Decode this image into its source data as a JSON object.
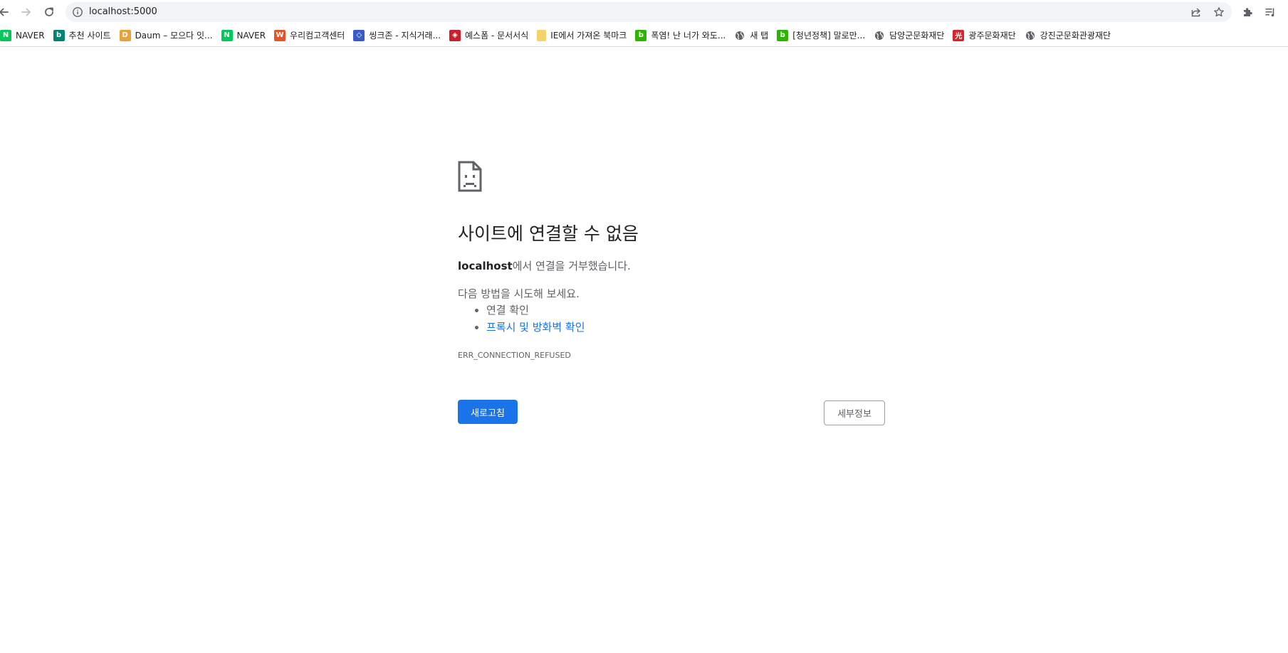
{
  "browser": {
    "url": "localhost:5000"
  },
  "bookmarks": [
    {
      "label": "NAVER",
      "favicon": "naver-icon",
      "color": "#03c75a",
      "glyph": "N"
    },
    {
      "label": "추천 사이트",
      "favicon": "bing-icon",
      "color": "#008373",
      "glyph": "b"
    },
    {
      "label": "Daum – 모으다 잇...",
      "favicon": "daum-icon",
      "color": "#e8a23c",
      "glyph": "D"
    },
    {
      "label": "NAVER",
      "favicon": "naver-icon",
      "color": "#03c75a",
      "glyph": "N"
    },
    {
      "label": "우리컴고객센터",
      "favicon": "wooricom-icon",
      "color": "#e2562b",
      "glyph": "W"
    },
    {
      "label": "씽크존 - 지식거래...",
      "favicon": "thinkzone-icon",
      "color": "#3a5bc7",
      "glyph": "◇"
    },
    {
      "label": "예스폼 - 문서서식",
      "favicon": "yesform-icon",
      "color": "#c8202f",
      "glyph": "◈"
    },
    {
      "label": "IE에서 가져온 북마크",
      "favicon": "folder-icon",
      "color": "#f6d36a",
      "glyph": ""
    },
    {
      "label": "폭염! 난 너가 와도...",
      "favicon": "blog-icon",
      "color": "#2db400",
      "glyph": "b"
    },
    {
      "label": "새 탭",
      "favicon": "globe-icon",
      "color": "#5f6368",
      "glyph": ""
    },
    {
      "label": "[청년정책] 말로만...",
      "favicon": "blog-icon",
      "color": "#2db400",
      "glyph": "b"
    },
    {
      "label": "담양군문화재단",
      "favicon": "globe-icon",
      "color": "#5f6368",
      "glyph": ""
    },
    {
      "label": "광주문화재단",
      "favicon": "gwangju-icon",
      "color": "#d8242c",
      "glyph": "光"
    },
    {
      "label": "강진군문화관광재단",
      "favicon": "globe-icon",
      "color": "#5f6368",
      "glyph": ""
    }
  ],
  "error": {
    "title": "사이트에 연결할 수 없음",
    "host": "localhost",
    "description_suffix": "에서 연결을 거부했습니다.",
    "try_label": "다음 방법을 시도해 보세요.",
    "suggestions": {
      "check_connection": "연결 확인",
      "check_proxy": "프록시 및 방화벽 확인"
    },
    "code": "ERR_CONNECTION_REFUSED",
    "reload_button": "새로고침",
    "details_button": "세부정보"
  },
  "colors": {
    "accent": "#1a73e8",
    "text": "#202124",
    "secondary_text": "#5f6368"
  }
}
